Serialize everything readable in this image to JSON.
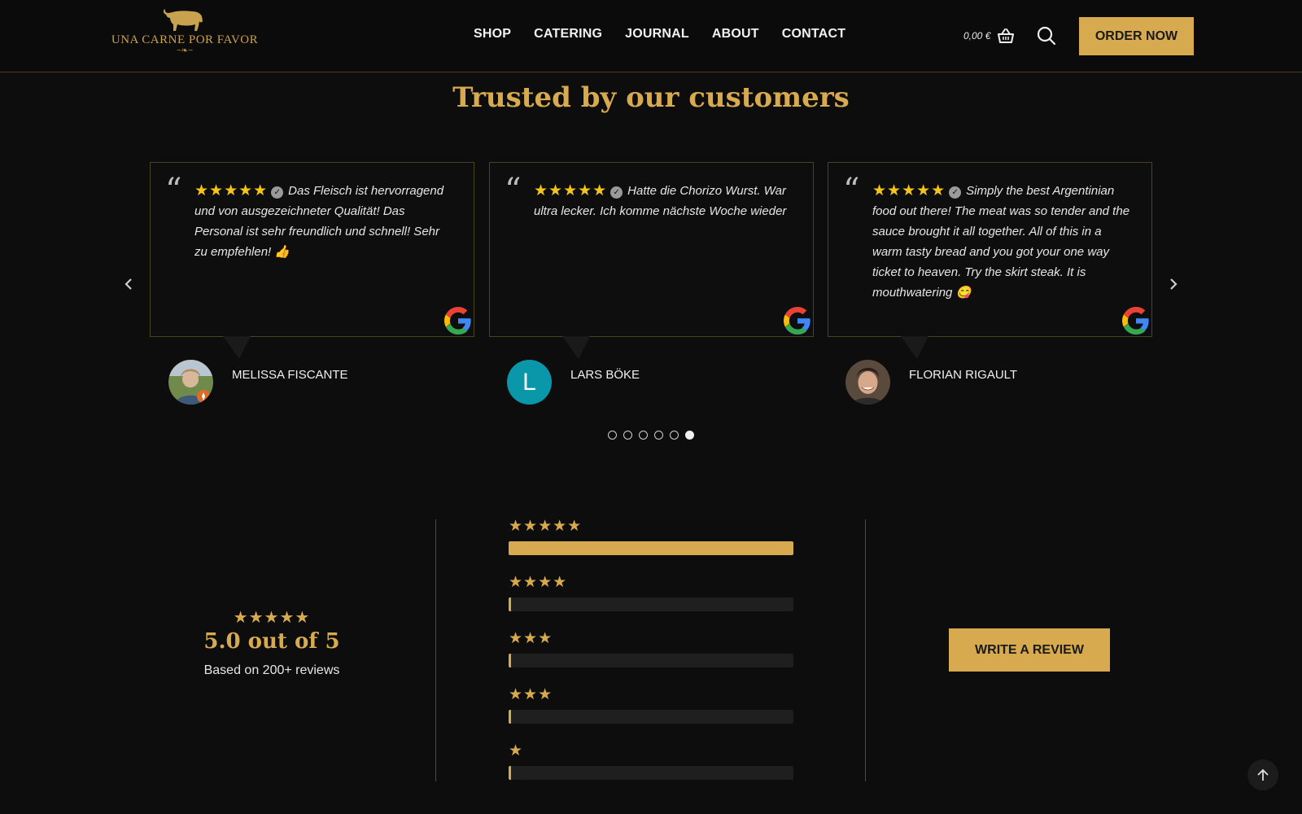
{
  "header": {
    "logo_text": "UNA CARNE POR FAVOR",
    "nav": [
      "SHOP",
      "CATERING",
      "JOURNAL",
      "ABOUT",
      "CONTACT"
    ],
    "cart_amount": "0,00 €",
    "order_label": "ORDER NOW"
  },
  "section_title": "Trusted by our customers",
  "reviews": [
    {
      "stars": "★★★★★",
      "text": "Das Fleisch ist hervorragend und von ausgezeichneter Qualität! Das Personal ist sehr freundlich und schnell! Sehr zu empfehlen! 👍",
      "name": "MELISSA FISCANTE"
    },
    {
      "stars": "★★★★★",
      "text": "Hatte die Chorizo Wurst. War ultra lecker. Ich komme nächste Woche wieder",
      "name": "LARS BÖKE",
      "avatar_letter": "L"
    },
    {
      "stars": "★★★★★",
      "text": "Simply the best Argentinian food out there! The meat was so tender and the sauce brought it all together. All of this in a warm tasty bread and you got your one way ticket to heaven. Try the skirt steak. It is mouthwatering 😋",
      "name": "FLORIAN RIGAULT"
    }
  ],
  "carousel": {
    "dots": 6,
    "active_dot": 6
  },
  "summary": {
    "stars": "★★★★★",
    "score": "5.0 out of 5",
    "based_on": "Based on 200+ reviews"
  },
  "rating_breakdown": [
    {
      "stars": "★★★★★",
      "share": 1.0
    },
    {
      "stars": "★★★★",
      "share": 0.0
    },
    {
      "stars": "★★★",
      "share": 0.0
    },
    {
      "stars": "★★★",
      "share": 0.0
    },
    {
      "stars": "★",
      "share": 0.0
    }
  ],
  "write_review_label": "WRITE A REVIEW",
  "colors": {
    "gold": "#d8aa4f",
    "background": "#0d0d0d",
    "star_yellow": "#f5c518"
  }
}
